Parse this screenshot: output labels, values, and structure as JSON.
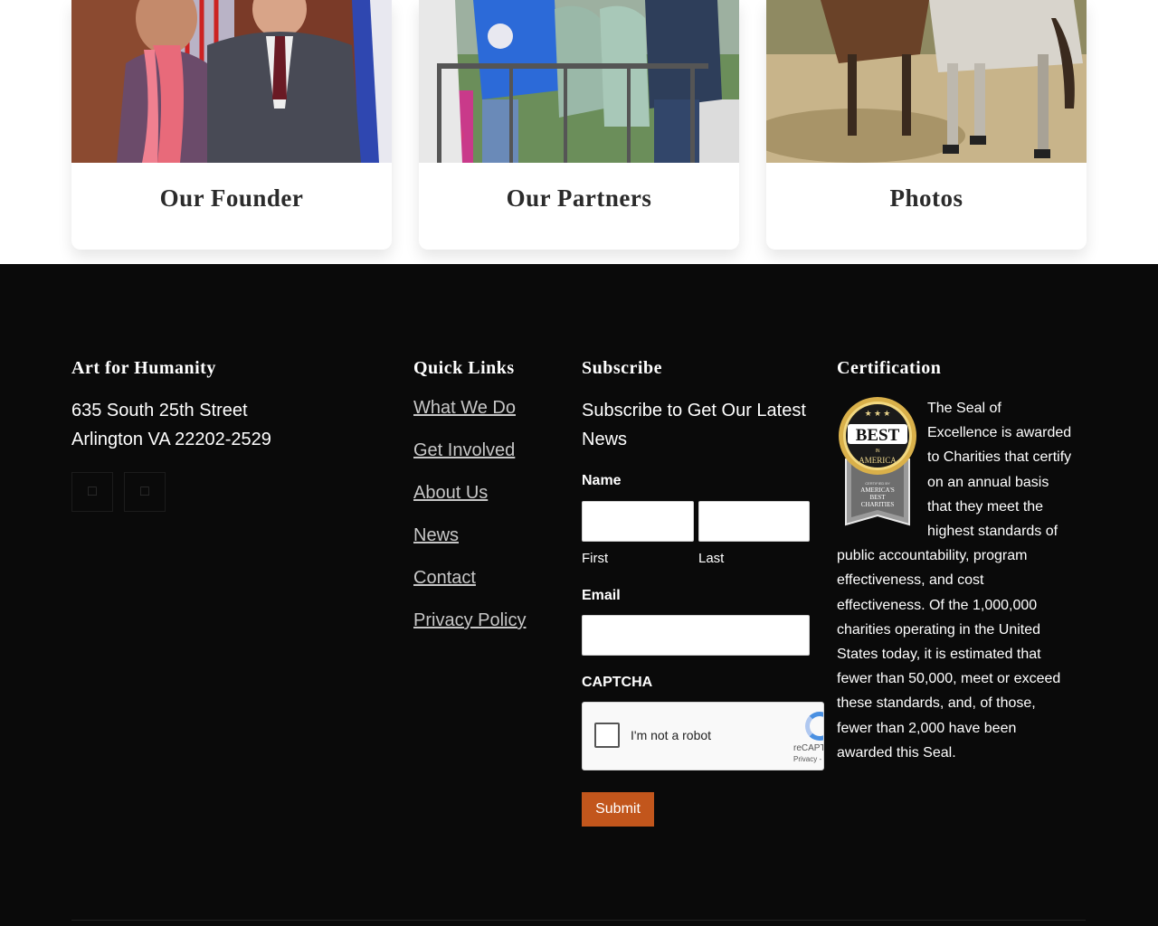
{
  "cards": [
    {
      "title": "Our Founder",
      "photo": "founder-photo"
    },
    {
      "title": "Our Partners",
      "photo": "partners-photo"
    },
    {
      "title": "Photos",
      "photo": "horses-photo"
    }
  ],
  "footer": {
    "org": {
      "heading": "Art for Humanity",
      "address_line1": "635 South 25th Street",
      "address_line2": "Arlington VA 22202-2529",
      "social_icons": [
        "facebook-icon",
        "twitter-icon"
      ]
    },
    "quick_links": {
      "heading": "Quick Links",
      "items": [
        "What We Do",
        "Get Involved",
        "About Us",
        "News",
        "Contact",
        "Privacy Policy"
      ]
    },
    "subscribe": {
      "heading": "Subscribe",
      "text": "Subscribe to Get Our Latest News",
      "name_label": "Name",
      "first_label": "First",
      "last_label": "Last",
      "email_label": "Email",
      "captcha_label": "CAPTCHA",
      "captcha_checkbox_text": "I'm not a robot",
      "captcha_brand": "reCAPTCHA",
      "captcha_privacy": "Privacy - Terms",
      "submit_label": "Submit"
    },
    "certification": {
      "heading": "Certification",
      "seal_top": "BEST",
      "seal_in": "IN",
      "seal_bottom": "AMERICA",
      "seal_certified": "CERTIFIED BY",
      "seal_org_line1": "AMERICA'S",
      "seal_org_line2": "BEST",
      "seal_org_line3": "CHARITIES",
      "text": "The Seal of Excellence is awarded to Charities that certify on an annual basis that they meet the highest standards of public accountability, program effectiveness, and cost effectiveness. Of the 1,000,000 charities operating in the United States today, it is estimated that fewer than 50,000, meet or exceed these standards, and, of those, fewer than 2,000 have been awarded this Seal."
    }
  }
}
